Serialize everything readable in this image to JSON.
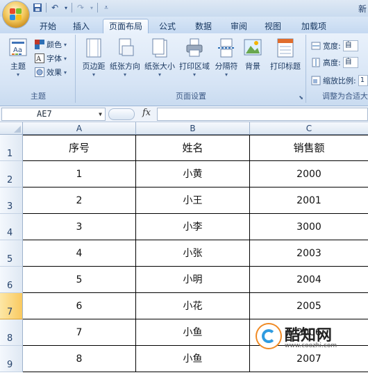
{
  "title_bar": {
    "title": "新"
  },
  "tabs": [
    "开始",
    "插入",
    "页面布局",
    "公式",
    "数据",
    "审阅",
    "视图",
    "加载项"
  ],
  "active_tab": "页面布局",
  "ribbon": {
    "theme_group": {
      "label": "主题",
      "theme_button": "主题",
      "colors": "颜色",
      "fonts": "字体",
      "effects": "效果"
    },
    "page_setup_group": {
      "label": "页面设置",
      "margins": "页边距",
      "orientation": "纸张方向",
      "size": "纸张大小",
      "print_area": "打印区域",
      "breaks": "分隔符",
      "background": "背景",
      "print_titles": "打印标题"
    },
    "scale_group": {
      "label": "调整为合适大",
      "width_label": "宽度:",
      "width_value": "自",
      "height_label": "高度:",
      "height_value": "自",
      "scale_label": "缩放比例:",
      "scale_value": "1"
    }
  },
  "formula_bar": {
    "name_box": "AE7",
    "fx": "fx",
    "formula": ""
  },
  "columns": [
    "A",
    "B",
    "C"
  ],
  "row_numbers": [
    "1",
    "2",
    "3",
    "4",
    "5",
    "6",
    "7",
    "8",
    "9"
  ],
  "selected_row": "7",
  "table": {
    "headers": [
      "序号",
      "姓名",
      "销售额"
    ],
    "rows": [
      [
        "1",
        "小黄",
        "2000"
      ],
      [
        "2",
        "小王",
        "2001"
      ],
      [
        "3",
        "小李",
        "3000"
      ],
      [
        "4",
        "小张",
        "2003"
      ],
      [
        "5",
        "小明",
        "2004"
      ],
      [
        "6",
        "小花",
        "2005"
      ],
      [
        "7",
        "小鱼",
        "2006"
      ],
      [
        "8",
        "小鱼",
        "2007"
      ]
    ]
  },
  "watermark": {
    "name": "酷知网",
    "url": "www.coozhi.com"
  },
  "colors": {
    "ribbon_bg": "#d6e4f5",
    "selected_row": "#f9c960",
    "watermark_orange": "#f08a24",
    "watermark_blue": "#2f9be0"
  }
}
